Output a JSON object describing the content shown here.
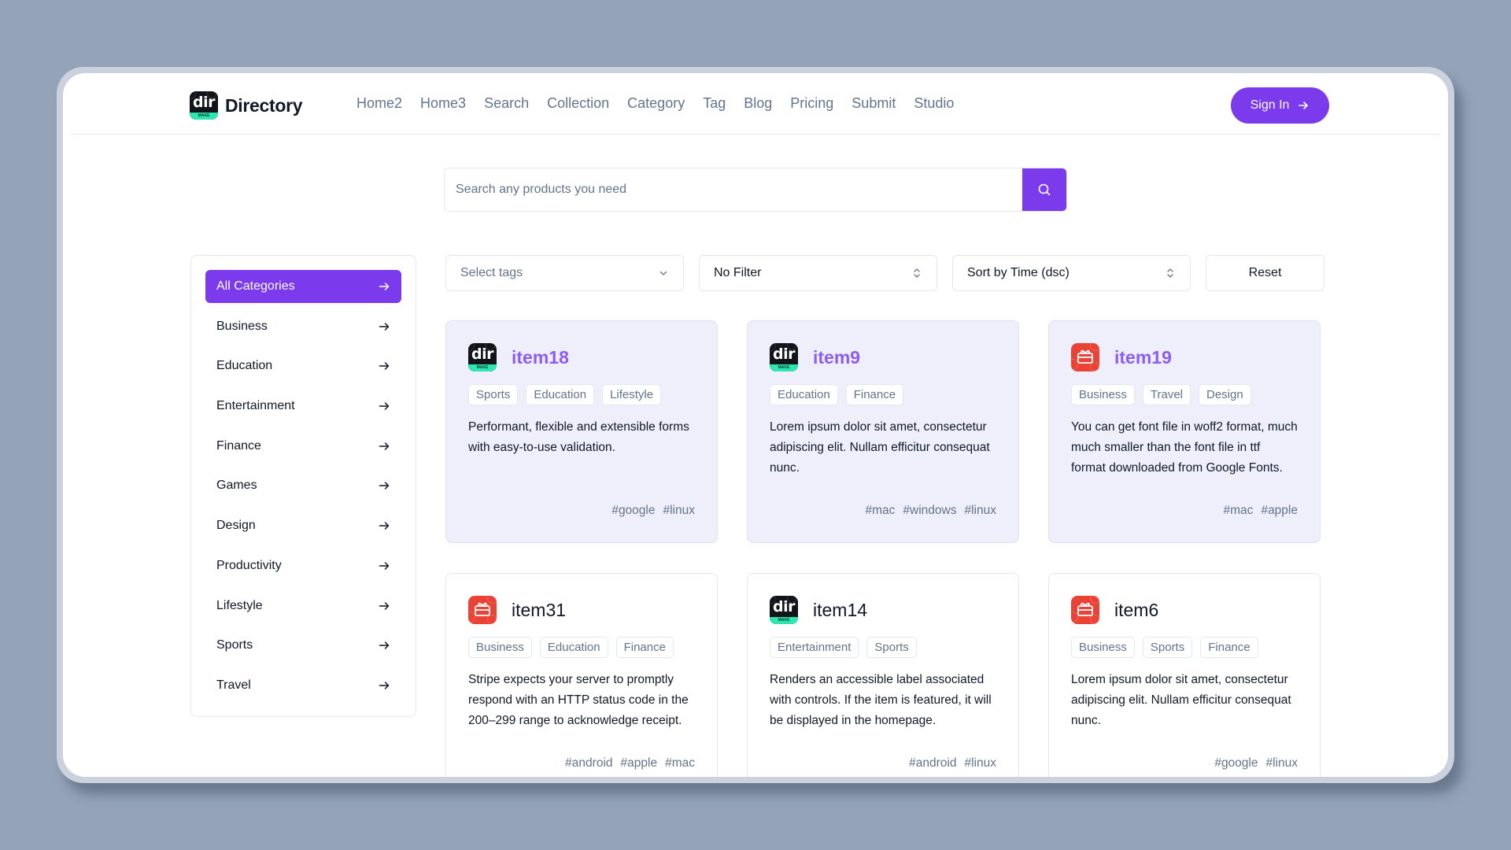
{
  "brand": {
    "name": "Directory",
    "logo_text": "dir",
    "logo_band": "MAKE"
  },
  "nav": [
    "Home2",
    "Home3",
    "Search",
    "Collection",
    "Category",
    "Tag",
    "Blog",
    "Pricing",
    "Submit",
    "Studio"
  ],
  "header": {
    "signin_label": "Sign In"
  },
  "search": {
    "placeholder": "Search any products you need",
    "value": ""
  },
  "sidebar": {
    "categories": [
      {
        "label": "All Categories",
        "active": true
      },
      {
        "label": "Business"
      },
      {
        "label": "Education"
      },
      {
        "label": "Entertainment"
      },
      {
        "label": "Finance"
      },
      {
        "label": "Games"
      },
      {
        "label": "Design"
      },
      {
        "label": "Productivity"
      },
      {
        "label": "Lifestyle"
      },
      {
        "label": "Sports"
      },
      {
        "label": "Travel"
      }
    ]
  },
  "filters": {
    "tags_placeholder": "Select tags",
    "filter_value": "No Filter",
    "sort_value": "Sort by Time (dsc)",
    "reset_label": "Reset"
  },
  "colors": {
    "accent": "#7c3aed",
    "featured_bg": "#efeffc",
    "featured_title": "#8b5cf6",
    "page_bg": "#94a3b8"
  },
  "items": [
    {
      "title": "item18",
      "icon": "dir-logo-icon",
      "featured": true,
      "tags": [
        "Sports",
        "Education",
        "Lifestyle"
      ],
      "description": "Performant, flexible and extensible forms with easy-to-use validation.",
      "hashtags": [
        "google",
        "linux"
      ]
    },
    {
      "title": "item9",
      "icon": "dir-logo-icon",
      "featured": true,
      "tags": [
        "Education",
        "Finance"
      ],
      "description": "Lorem ipsum dolor sit amet, consectetur adipiscing elit. Nullam efficitur consequat nunc.",
      "hashtags": [
        "mac",
        "windows",
        "linux"
      ]
    },
    {
      "title": "item19",
      "icon": "gift-card-icon",
      "featured": true,
      "tags": [
        "Business",
        "Travel",
        "Design"
      ],
      "description": "You can get font file in woff2 format, much much smaller than the font file in ttf format downloaded from Google Fonts.",
      "hashtags": [
        "mac",
        "apple"
      ]
    },
    {
      "title": "item31",
      "icon": "gift-card-icon",
      "featured": false,
      "tags": [
        "Business",
        "Education",
        "Finance"
      ],
      "description": "Stripe expects your server to promptly respond with an HTTP status code in the 200–299 range to acknowledge receipt.",
      "hashtags": [
        "android",
        "apple",
        "mac"
      ]
    },
    {
      "title": "item14",
      "icon": "dir-logo-icon",
      "featured": false,
      "tags": [
        "Entertainment",
        "Sports"
      ],
      "description": "Renders an accessible label associated with controls. If the item is featured, it will be displayed in the homepage.",
      "hashtags": [
        "android",
        "linux"
      ]
    },
    {
      "title": "item6",
      "icon": "gift-card-icon",
      "featured": false,
      "tags": [
        "Business",
        "Sports",
        "Finance"
      ],
      "description": "Lorem ipsum dolor sit amet, consectetur adipiscing elit. Nullam efficitur consequat nunc.",
      "hashtags": [
        "google",
        "linux"
      ]
    }
  ]
}
